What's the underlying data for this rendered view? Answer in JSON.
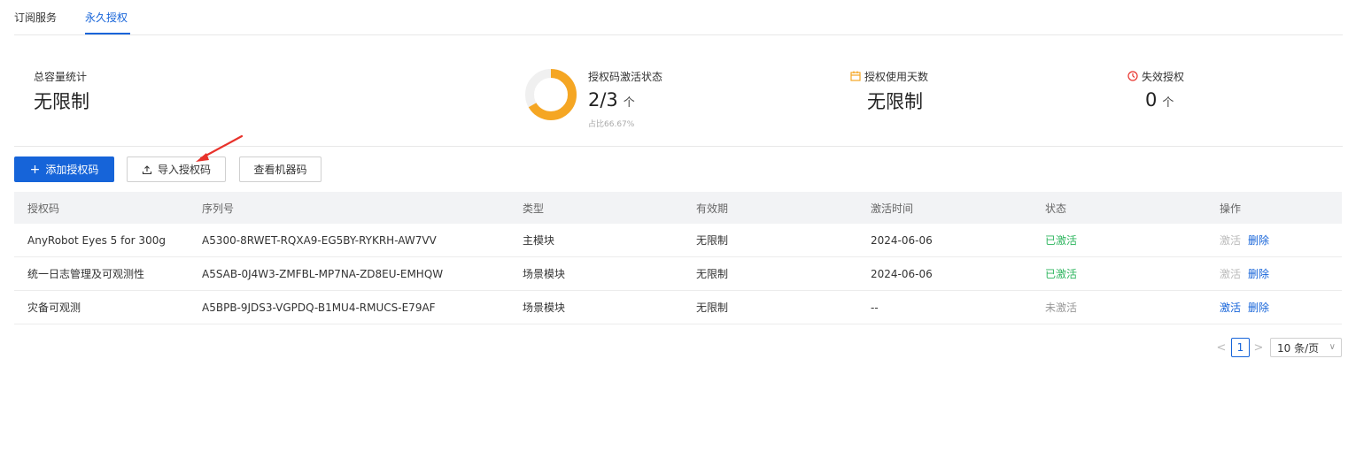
{
  "tabs": [
    {
      "label": "订阅服务"
    },
    {
      "label": "永久授权"
    }
  ],
  "stats": {
    "capacity": {
      "label": "总容量统计",
      "value": "无限制"
    },
    "activation": {
      "label": "授权码激活状态",
      "value": "2/3",
      "unit": "个",
      "ratio_text": "占比66.67%",
      "ratio": 0.6667
    },
    "days": {
      "label": "授权使用天数",
      "value": "无限制",
      "icon": "calendar-icon"
    },
    "invalid": {
      "label": "失效授权",
      "value": "0",
      "unit": "个",
      "icon": "clock-icon"
    }
  },
  "toolbar": {
    "add_label": "添加授权码",
    "import_label": "导入授权码",
    "machine_label": "查看机器码"
  },
  "table": {
    "headers": [
      "授权码",
      "序列号",
      "类型",
      "有效期",
      "激活时间",
      "状态",
      "操作"
    ],
    "rows": [
      {
        "name": "AnyRobot Eyes 5 for 300g",
        "serial": "A5300-8RWET-RQXA9-EG5BY-RYKRH-AW7VV",
        "type": "主模块",
        "validity": "无限制",
        "activated_at": "2024-06-06",
        "status": "已激活",
        "activate": "激活",
        "delete": "删除"
      },
      {
        "name": "统一日志管理及可观测性",
        "serial": "A5SAB-0J4W3-ZMFBL-MP7NA-ZD8EU-EMHQW",
        "type": "场景模块",
        "validity": "无限制",
        "activated_at": "2024-06-06",
        "status": "已激活",
        "activate": "激活",
        "delete": "删除"
      },
      {
        "name": "灾备可观测",
        "serial": "A5BPB-9JDS3-VGPDQ-B1MU4-RMUCS-E79AF",
        "type": "场景模块",
        "validity": "无限制",
        "activated_at": "--",
        "status": "未激活",
        "activate": "激活",
        "delete": "删除"
      }
    ]
  },
  "pagination": {
    "prev": "<",
    "current_page": "1",
    "next": ">",
    "page_size": "10 条/页"
  },
  "colors": {
    "primary": "#1664d9",
    "success": "#2fb65f",
    "donut": "#f5a623",
    "donut_track": "#f0f0f0",
    "annotation": "#e8322b"
  }
}
